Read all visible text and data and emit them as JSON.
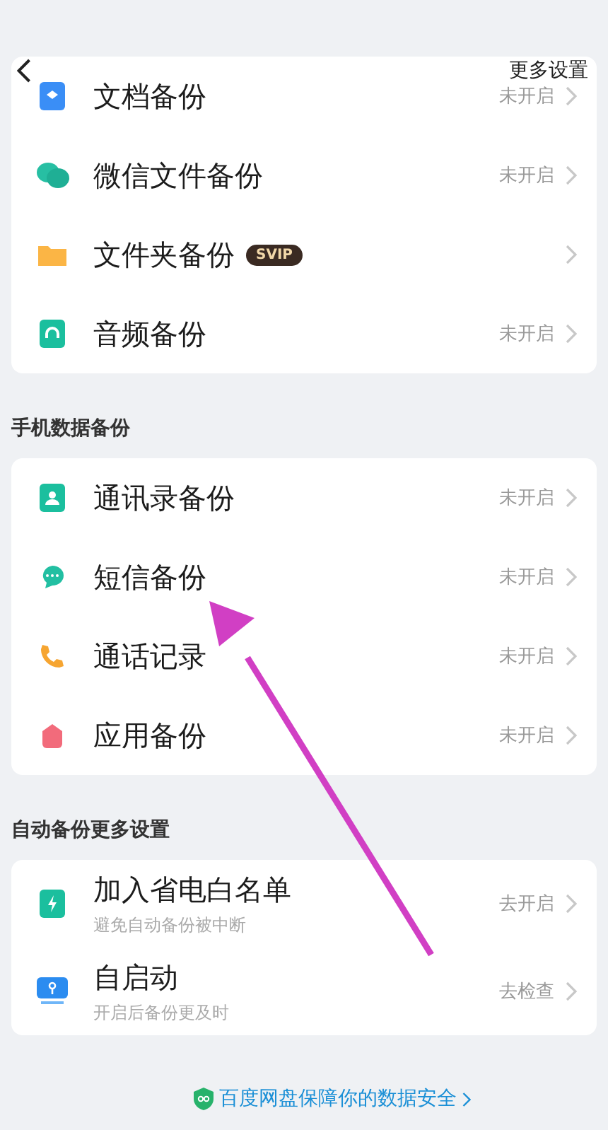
{
  "header": {
    "action": "更多设置"
  },
  "sections": [
    {
      "items": [
        {
          "label": "文档备份",
          "status": "未开启"
        },
        {
          "label": "微信文件备份",
          "status": "未开启"
        },
        {
          "label": "文件夹备份",
          "badge": "SVIP"
        },
        {
          "label": "音频备份",
          "status": "未开启"
        }
      ]
    },
    {
      "title": "手机数据备份",
      "items": [
        {
          "label": "通讯录备份",
          "status": "未开启"
        },
        {
          "label": "短信备份",
          "status": "未开启"
        },
        {
          "label": "通话记录",
          "status": "未开启"
        },
        {
          "label": "应用备份",
          "status": "未开启"
        }
      ]
    },
    {
      "title": "自动备份更多设置",
      "items": [
        {
          "label": "加入省电白名单",
          "subtitle": "避免自动备份被中断",
          "status": "去开启"
        },
        {
          "label": "自启动",
          "subtitle": "开启后备份更及时",
          "status": "去检查"
        }
      ]
    }
  ],
  "footer": {
    "link": "百度网盘保障你的数据安全"
  }
}
